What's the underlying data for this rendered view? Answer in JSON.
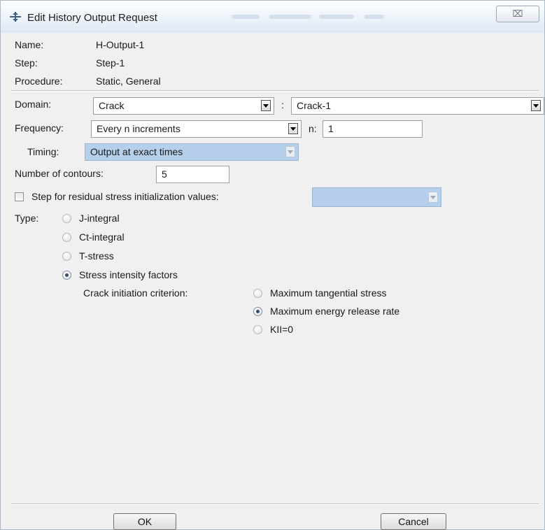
{
  "window": {
    "title": "Edit History Output Request",
    "close_symbol": "⌧"
  },
  "info": {
    "name_label": "Name:",
    "name_value": "H-Output-1",
    "step_label": "Step:",
    "step_value": "Step-1",
    "procedure_label": "Procedure:",
    "procedure_value": "Static, General"
  },
  "domain": {
    "label": "Domain:",
    "value": "Crack",
    "separator": ":",
    "sub_value": "Crack-1"
  },
  "frequency": {
    "label": "Frequency:",
    "value": "Every n increments",
    "n_label": "n:",
    "n_value": "1"
  },
  "timing": {
    "label": "Timing:",
    "value": "Output at exact times"
  },
  "contours": {
    "label": "Number of contours:",
    "value": "5"
  },
  "residual": {
    "label": "Step for residual stress initialization values:",
    "checked": false,
    "value": ""
  },
  "type": {
    "label": "Type:",
    "options": [
      {
        "label": "J-integral",
        "checked": false
      },
      {
        "label": "Ct-integral",
        "checked": false
      },
      {
        "label": "T-stress",
        "checked": false
      },
      {
        "label": "Stress intensity factors",
        "checked": true
      }
    ]
  },
  "criterion": {
    "label": "Crack initiation criterion:",
    "options": [
      {
        "label": "Maximum tangential stress",
        "checked": false
      },
      {
        "label": "Maximum energy release rate",
        "checked": true
      },
      {
        "label": "KII=0",
        "checked": false
      }
    ]
  },
  "buttons": {
    "ok": "OK",
    "cancel": "Cancel"
  },
  "colors": {
    "selection": "#b6d0ec",
    "dialog_bg": "#f0f0f0",
    "radio_dot": "#2d4d74"
  }
}
